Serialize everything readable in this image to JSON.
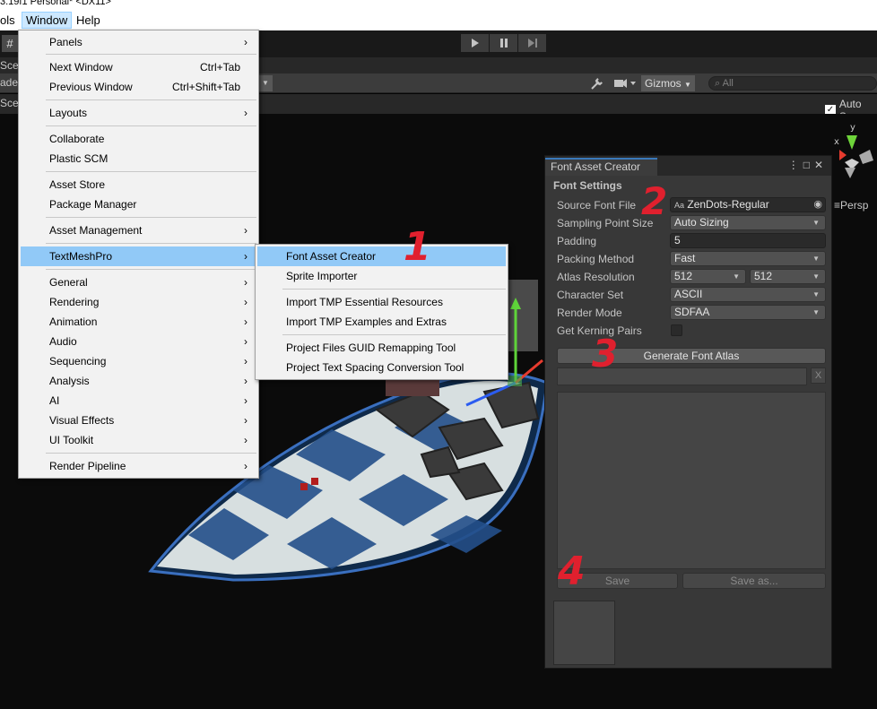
{
  "window_title": "3.19f1 Personal* <DX11>",
  "menubar": {
    "tools": "ols",
    "window": "Window",
    "help": "Help"
  },
  "toolbar": {
    "left_icon": "#"
  },
  "scene_toolbar": {
    "gizmos": "Gizmos",
    "search_placeholder": "All",
    "auto_save": "Auto Sa",
    "persp": "Persp"
  },
  "left_labels": [
    "Sce",
    "ade",
    "Sce"
  ],
  "window_menu": {
    "items": [
      {
        "label": "Panels",
        "submenu": true
      },
      {
        "label": "Next Window",
        "shortcut": "Ctrl+Tab"
      },
      {
        "label": "Previous Window",
        "shortcut": "Ctrl+Shift+Tab"
      },
      {
        "label": "Layouts",
        "submenu": true
      },
      {
        "label": "Collaborate"
      },
      {
        "label": "Plastic SCM"
      },
      {
        "label": "Asset Store"
      },
      {
        "label": "Package Manager"
      },
      {
        "label": "Asset Management",
        "submenu": true
      },
      {
        "label": "TextMeshPro",
        "submenu": true,
        "highlighted": true
      },
      {
        "label": "General",
        "submenu": true
      },
      {
        "label": "Rendering",
        "submenu": true
      },
      {
        "label": "Animation",
        "submenu": true
      },
      {
        "label": "Audio",
        "submenu": true
      },
      {
        "label": "Sequencing",
        "submenu": true
      },
      {
        "label": "Analysis",
        "submenu": true
      },
      {
        "label": "AI",
        "submenu": true
      },
      {
        "label": "Visual Effects",
        "submenu": true
      },
      {
        "label": "UI Toolkit",
        "submenu": true
      },
      {
        "label": "Render Pipeline",
        "submenu": true
      }
    ]
  },
  "tmp_submenu": {
    "items": [
      {
        "label": "Font Asset Creator",
        "highlighted": true
      },
      {
        "label": "Sprite Importer"
      },
      {
        "label": "Import TMP Essential Resources"
      },
      {
        "label": "Import TMP Examples and Extras"
      },
      {
        "label": "Project Files GUID Remapping Tool"
      },
      {
        "label": "Project Text Spacing Conversion Tool"
      }
    ]
  },
  "font_asset_creator": {
    "tab_title": "Font Asset Creator",
    "section_heading": "Font Settings",
    "source_font_file": {
      "label": "Source Font File",
      "value": "ZenDots-Regular",
      "icon_text": "Aa"
    },
    "sampling_point_size": {
      "label": "Sampling Point Size",
      "value": "Auto Sizing"
    },
    "padding": {
      "label": "Padding",
      "value": "5"
    },
    "packing_method": {
      "label": "Packing Method",
      "value": "Fast"
    },
    "atlas_resolution": {
      "label": "Atlas Resolution",
      "width": "512",
      "height": "512"
    },
    "character_set": {
      "label": "Character Set",
      "value": "ASCII"
    },
    "render_mode": {
      "label": "Render Mode",
      "value": "SDFAA"
    },
    "get_kerning_pairs": {
      "label": "Get Kerning Pairs",
      "checked": false
    },
    "generate_button": "Generate Font Atlas",
    "clear_button": "X",
    "save_button": "Save",
    "save_as_button": "Save as..."
  },
  "annotations": [
    "1",
    "2",
    "3",
    "4"
  ]
}
